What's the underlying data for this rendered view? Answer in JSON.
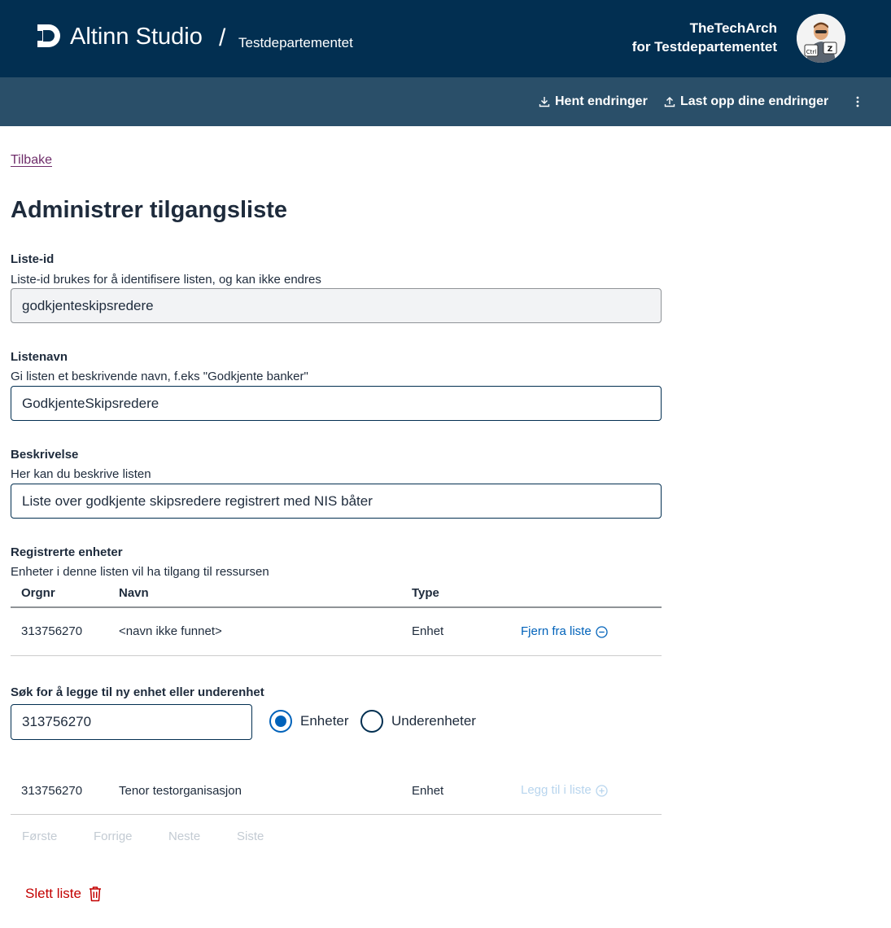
{
  "header": {
    "brand": "Altinn Studio",
    "separator": "/",
    "organization": "Testdepartementet",
    "user_name": "TheTechArch",
    "user_org": "for Testdepartementet"
  },
  "toolbar": {
    "fetch_label": "Hent endringer",
    "upload_label": "Last opp dine endringer"
  },
  "back_link": "Tilbake",
  "page_title": "Administrer tilgangsliste",
  "fields": {
    "list_id": {
      "label": "Liste-id",
      "hint": "Liste-id brukes for å identifisere listen, og kan ikke endres",
      "value": "godkjenteskipsredere"
    },
    "list_name": {
      "label": "Listenavn",
      "hint": "Gi listen et beskrivende navn, f.eks \"Godkjente banker\"",
      "value": "GodkjenteSkipsredere"
    },
    "description": {
      "label": "Beskrivelse",
      "hint": "Her kan du beskrive listen",
      "value": "Liste over godkjente skipsredere registrert med NIS båter"
    }
  },
  "registered": {
    "label": "Registrerte enheter",
    "hint": "Enheter i denne listen vil ha tilgang til ressursen",
    "columns": [
      "Orgnr",
      "Navn",
      "Type"
    ],
    "rows": [
      {
        "orgnr": "313756270",
        "name": "<navn ikke funnet>",
        "type": "Enhet",
        "action": "Fjern fra liste"
      }
    ]
  },
  "search": {
    "label": "Søk for å legge til ny enhet eller underenhet",
    "value": "313756270",
    "options": [
      {
        "label": "Enheter",
        "checked": true
      },
      {
        "label": "Underenheter",
        "checked": false
      }
    ],
    "results": [
      {
        "orgnr": "313756270",
        "name": "Tenor testorganisasjon",
        "type": "Enhet",
        "action": "Legg til i liste"
      }
    ]
  },
  "pagination": [
    "Første",
    "Forrige",
    "Neste",
    "Siste"
  ],
  "delete_label": "Slett liste",
  "colors": {
    "header_bg": "#022f51",
    "subheader_bg": "#2a4f69",
    "link_purple": "#6f2d6a",
    "action_blue": "#0062ba",
    "danger_red": "#c30000"
  },
  "icons": [
    "download-icon",
    "upload-icon",
    "kebab-menu-icon",
    "remove-circle-icon",
    "add-circle-icon",
    "trash-icon"
  ]
}
